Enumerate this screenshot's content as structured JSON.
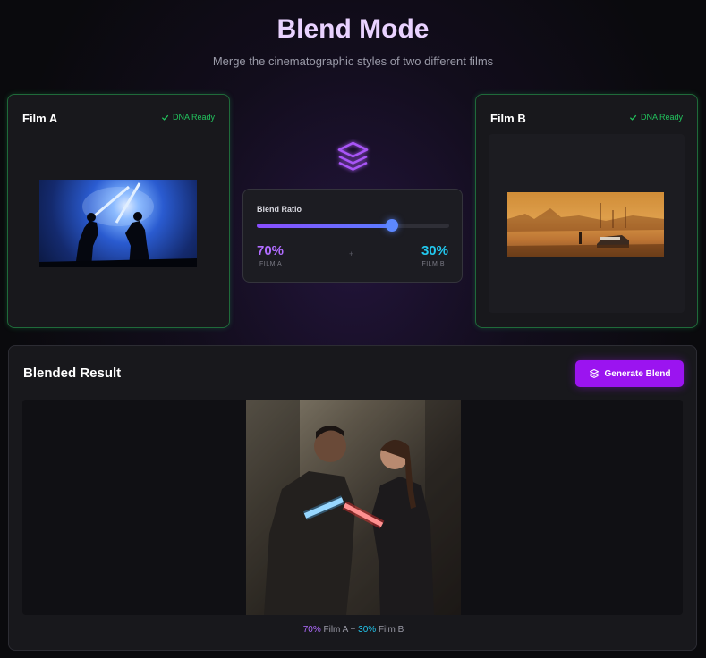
{
  "header": {
    "title": "Blend Mode",
    "subtitle": "Merge the cinematographic styles of two different films"
  },
  "film_a": {
    "label": "Film A",
    "status": "DNA Ready",
    "status_icon": "check-icon"
  },
  "film_b": {
    "label": "Film B",
    "status": "DNA Ready",
    "status_icon": "check-icon"
  },
  "blend_ratio": {
    "title": "Blend Ratio",
    "value": 0.7,
    "film_a_percent": "70%",
    "film_a_label": "FILM A",
    "film_b_percent": "30%",
    "film_b_label": "FILM B",
    "separator": "+"
  },
  "result": {
    "title": "Blended Result",
    "generate_button_label": "Generate Blend",
    "caption": {
      "a_percent": "70%",
      "a_text": "Film A",
      "plus": "+",
      "b_percent": "30%",
      "b_text": "Film B"
    }
  },
  "colors": {
    "accent_purple": "#9b14f0",
    "film_a_color": "#b06cff",
    "film_b_color": "#22c7ee",
    "ready_green": "#22c55e"
  }
}
